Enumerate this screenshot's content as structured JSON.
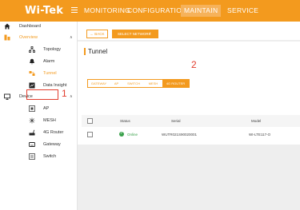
{
  "header": {
    "logo": "Wi-Tek",
    "nav": [
      "MONITORING",
      "CONFIGURATION",
      "MAINTAIN",
      "SERVICE"
    ],
    "active_nav": "MAINTAIN",
    "brand_color": "#f39a1e"
  },
  "sidebar": {
    "items": [
      {
        "label": "Dashboard",
        "icon": "home-icon"
      },
      {
        "label": "Overview",
        "icon": "chart-icon",
        "expanded": true
      },
      {
        "label": "Topology",
        "icon": "topology-icon"
      },
      {
        "label": "Alarm",
        "icon": "bell-icon"
      },
      {
        "label": "Tunnel",
        "icon": "tunnel-icon",
        "selected": true
      },
      {
        "label": "Data Insight",
        "icon": "insight-icon"
      },
      {
        "label": "Device",
        "icon": "monitor-icon",
        "expanded": true
      },
      {
        "label": "AP",
        "icon": "ap-icon"
      },
      {
        "label": "MESH",
        "icon": "mesh-icon"
      },
      {
        "label": "4G Router",
        "icon": "router-icon"
      },
      {
        "label": "Gateway",
        "icon": "gateway-icon"
      },
      {
        "label": "Switch",
        "icon": "switch-icon"
      }
    ]
  },
  "toolbar": {
    "back_label": "← BACK",
    "select_label": "SELECT NETWORK"
  },
  "panel": {
    "title": "Tunnel",
    "tabs": [
      "GATEWAY",
      "AP",
      "SWITCH",
      "MESH",
      "4G ROUTER"
    ],
    "active_tab": "4G ROUTER",
    "columns": [
      "Status",
      "Serial",
      "Model"
    ],
    "rows": [
      {
        "status": "Online",
        "serial": "WUTR021S90020001",
        "model": "WI-LTE117-O"
      }
    ]
  },
  "annotations": [
    "1",
    "2"
  ]
}
